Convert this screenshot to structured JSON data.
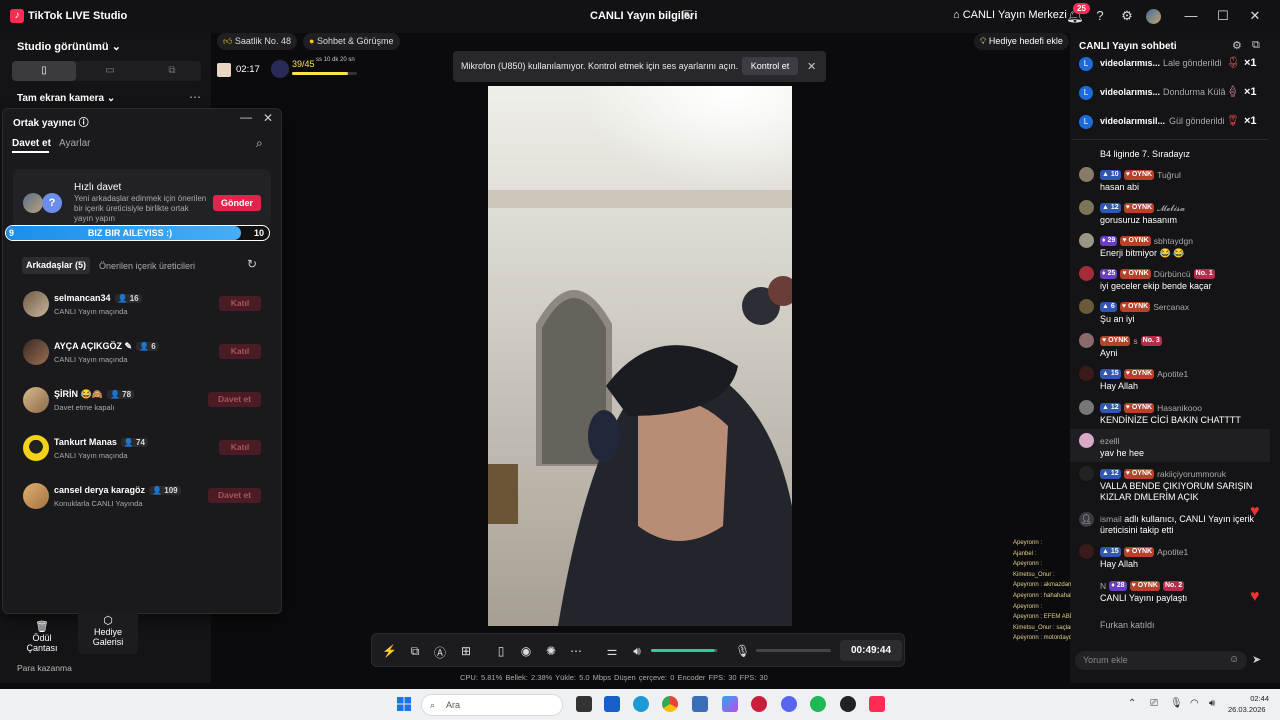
{
  "titlebar": {
    "app_title": "TikTok LIVE Studio",
    "live_info": "CANLI Yayın bilgileri",
    "live_center": "CANLI Yayın Merkezi",
    "notif_count": "25"
  },
  "left": {
    "studio_view": "Studio görünümü",
    "camera_label": "Tam ekran kamera",
    "gift_bag": "Ödül Çantası",
    "gift_gallery": "Hediye Galerisi",
    "earn": "Para kazanma"
  },
  "cohost": {
    "title": "Ortak yayıncı",
    "tab_invite": "Davet et",
    "tab_settings": "Ayarlar",
    "quick_title": "Hızlı davet",
    "quick_desc": "Yeni arkadaşlar edinmek için önerilen bir içerik üreticisiyle birlikte ortak yayın yapın",
    "send": "Gönder",
    "progress": {
      "left": "9",
      "text": "BIZ BIR AILEYISS :)",
      "right": "10",
      "fraction": 0.9
    },
    "friends_tab": "Arkadaşlar (5)",
    "creators_tab": "Önerilen içerik üreticileri",
    "friends": [
      {
        "name": "selmancan34",
        "count": "16",
        "sub": "CANLI Yayın maçında",
        "btn": "Katıl"
      },
      {
        "name": "AYÇA AÇIKGÖZ",
        "count": "6",
        "sub": "CANLI Yayın maçında",
        "btn": "Katıl"
      },
      {
        "name": "ŞİRİN",
        "count": "78",
        "sub": "Davet etme kapalı",
        "btn": "Davet et"
      },
      {
        "name": "Tankurt Manas",
        "count": "74",
        "sub": "CANLI Yayın maçında",
        "btn": "Katıl"
      },
      {
        "name": "cansel derya karagöz",
        "count": "109",
        "sub": "Konuklarla CANLI Yayında",
        "btn": "Davet et"
      }
    ]
  },
  "stage": {
    "rank": "Saatlik No. 48",
    "chat_pill": "Sohbet & Görüşme",
    "box_time": "02:17",
    "goal_count": "39/45",
    "goal_timer": "ss 10 dk 20 sn",
    "gift_goal": "Hediye hedefi ekle",
    "mic_toast": "Mikrofon (U850) kullanılamıyor. Kontrol etmek için ses ayarlarını açın.",
    "mic_check": "Kontrol et",
    "timer": "00:49:44",
    "stats": "CPU:  5.81%     Bellek:  2.38%     Yükle:  5.0 Mbps     Düşen çerçeve:  0     Encoder FPS:  30     FPS:  30"
  },
  "chat": {
    "title": "CANLI Yayın sohbeti",
    "gifts": [
      {
        "name": "videolarımıs...",
        "what": "Lale gönderildi",
        "qty": "×1"
      },
      {
        "name": "videolarımıs...",
        "what": "Dondurma Külâ",
        "qty": "×1"
      },
      {
        "name": "videolarımısil...",
        "what": "Gül gönderildi",
        "qty": "×1"
      }
    ],
    "messages": [
      {
        "user": "",
        "text": "B4 liginde 7. Sıradayız",
        "lvl": "",
        "no": ""
      },
      {
        "user": "Tuğrul",
        "text": "hasan abi",
        "lvl": "10",
        "no": ""
      },
      {
        "user": "𝓜𝓮𝓵𝓲𝓼𝓪",
        "text": "gorusuruz hasanım",
        "lvl": "12",
        "no": ""
      },
      {
        "user": "sbhtaydgn",
        "text": "Enerji bitmiyor 😂 😂",
        "lvl": "29",
        "no": ""
      },
      {
        "user": "Dürbüncü",
        "text": "iyi geceler ekip bende kaçar",
        "lvl": "25",
        "no": "No. 1"
      },
      {
        "user": "Sercanax",
        "text": "Şu an iyi",
        "lvl": "6",
        "no": ""
      },
      {
        "user": "s",
        "text": "Ayni",
        "lvl": "",
        "no": "No. 3"
      },
      {
        "user": "Apotite1",
        "text": "Hay Allah",
        "lvl": "15",
        "no": ""
      },
      {
        "user": "Hasanikooo",
        "text": "KENDİNİZE CİCİ BAKIN CHATTTT",
        "lvl": "12",
        "no": ""
      },
      {
        "user": "ezelll",
        "text": "yav he hee",
        "lvl": "",
        "no": ""
      },
      {
        "user": "rakiiçiyorummoruk",
        "text": "VALLA BENDE ÇIKIYORUM SARIŞIN KIZLAR DMLERİM AÇIK",
        "lvl": "12",
        "no": ""
      },
      {
        "user": "ismail",
        "text": "adlı kullanıcı, CANLI Yayın içerik üreticisini takip etti",
        "lvl": "",
        "no": ""
      },
      {
        "user": "Apotite1",
        "text": "Hay Allah",
        "lvl": "15",
        "no": ""
      },
      {
        "user": "N",
        "text": "CANLI Yayını paylaştı",
        "lvl": "28",
        "no": "No. 2"
      },
      {
        "user": "Furkan",
        "text": "katıldı",
        "lvl": "",
        "no": ""
      }
    ],
    "oynk": "OYNK",
    "input_placeholder": "Yorum ekle"
  },
  "overlay_feed": [
    "Apeyronn :",
    "Ajanbel :",
    "Apeyronn :",
    "Kimetsu_Onur :",
    "Apeyronn : akmazdan bi çen lirbüt",
    "Apeyronn : hahahahaha",
    "Apeyronn :",
    "Apeyronn : EFEM ABİN YAYINI BEKLERKEN KOLTUKTA UYUYA KALMIŞ AMK",
    "Kimetsu_Onur : saçlar fena olmuş bu arada",
    "Apeyronn : motordaydımmm , efemmm fenna sıesadımmm varsa bir 8oooog ayindddd içerim"
  ],
  "taskbar": {
    "search": "Ara",
    "time": "02:44",
    "date": "26.03.2026"
  }
}
